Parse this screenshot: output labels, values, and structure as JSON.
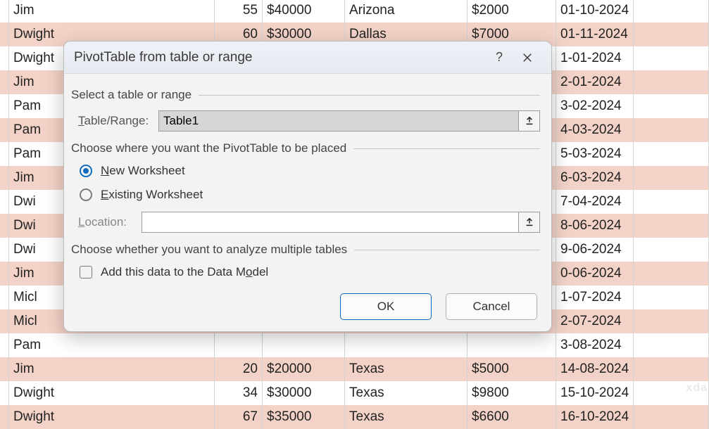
{
  "rows": [
    {
      "name": "Jim",
      "num": "55",
      "amt": "$40000",
      "loc": "Arizona",
      "amt2": "$2000",
      "date": "01-10-2024"
    },
    {
      "name": "Dwight",
      "num": "60",
      "amt": "$30000",
      "loc": "Dallas",
      "amt2": "$7000",
      "date": "01-11-2024"
    },
    {
      "name": "Dwight",
      "num": "",
      "amt": "",
      "loc": "",
      "amt2": "",
      "date": "1-01-2024"
    },
    {
      "name": "Jim",
      "num": "",
      "amt": "",
      "loc": "",
      "amt2": "",
      "date": "2-01-2024"
    },
    {
      "name": "Pam",
      "num": "",
      "amt": "",
      "loc": "",
      "amt2": "",
      "date": "3-02-2024"
    },
    {
      "name": "Pam",
      "num": "",
      "amt": "",
      "loc": "",
      "amt2": "",
      "date": "4-03-2024"
    },
    {
      "name": "Pam",
      "num": "",
      "amt": "",
      "loc": "",
      "amt2": "",
      "date": "5-03-2024"
    },
    {
      "name": "Jim",
      "num": "",
      "amt": "",
      "loc": "",
      "amt2": "",
      "date": "6-03-2024"
    },
    {
      "name": "Dwi",
      "num": "",
      "amt": "",
      "loc": "",
      "amt2": "",
      "date": "7-04-2024"
    },
    {
      "name": "Dwi",
      "num": "",
      "amt": "",
      "loc": "",
      "amt2": "",
      "date": "8-06-2024"
    },
    {
      "name": "Dwi",
      "num": "",
      "amt": "",
      "loc": "",
      "amt2": "",
      "date": "9-06-2024"
    },
    {
      "name": "Jim",
      "num": "",
      "amt": "",
      "loc": "",
      "amt2": "",
      "date": "0-06-2024"
    },
    {
      "name": "Micl",
      "num": "",
      "amt": "",
      "loc": "",
      "amt2": "",
      "date": "1-07-2024"
    },
    {
      "name": "Micl",
      "num": "",
      "amt": "",
      "loc": "",
      "amt2": "",
      "date": "2-07-2024"
    },
    {
      "name": "Pam",
      "num": "",
      "amt": "",
      "loc": "",
      "amt2": "",
      "date": "3-08-2024"
    },
    {
      "name": "Jim",
      "num": "20",
      "amt": "$20000",
      "loc": "Texas",
      "amt2": "$5000",
      "date": "14-08-2024"
    },
    {
      "name": "Dwight",
      "num": "34",
      "amt": "$30000",
      "loc": "Texas",
      "amt2": "$9800",
      "date": "15-10-2024"
    },
    {
      "name": "Dwight",
      "num": "67",
      "amt": "$35000",
      "loc": "Texas",
      "amt2": "$6600",
      "date": "16-10-2024"
    }
  ],
  "dialog": {
    "title": "PivotTable from table or range",
    "section_select": "Select a table or range",
    "table_range_label": "Table/Range:",
    "table_range_value": "Table1",
    "section_placement": "Choose where you want the PivotTable to be placed",
    "radio_new_pre": "N",
    "radio_new_post": "ew Worksheet",
    "radio_existing_pre": "E",
    "radio_existing_post": "xisting Worksheet",
    "location_label": "Location:",
    "location_value": "",
    "section_multi": "Choose whether you want to analyze multiple tables",
    "check_model_pre": "Add this data to the Data M",
    "check_model_post": "odel",
    "ok": "OK",
    "cancel": "Cancel"
  },
  "watermark": "xda"
}
